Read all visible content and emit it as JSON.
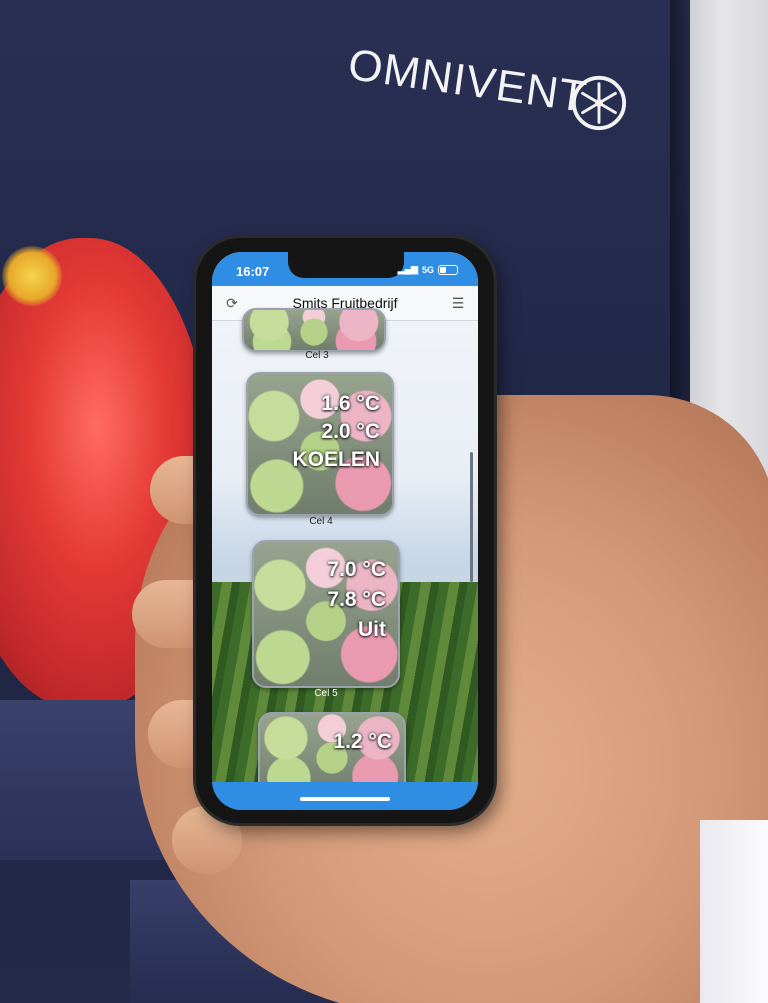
{
  "brand": {
    "name": "OMNIVENT",
    "icon": "fan-icon"
  },
  "phone": {
    "status_bar": {
      "time": "16:07",
      "network": "5G",
      "signal_icon": "signal-icon",
      "battery_icon": "battery-icon"
    },
    "header": {
      "title": "Smits Fruitbedrijf",
      "refresh_icon": "refresh-icon",
      "menu_icon": "list-menu-icon"
    },
    "cells": [
      {
        "label": "Cel 3",
        "temp1": "",
        "temp2": "",
        "status": ""
      },
      {
        "label": "Cel 4",
        "temp1": "1.6 °C",
        "temp2": "2.0 °C",
        "status": "KOELEN"
      },
      {
        "label": "Cel 5",
        "temp1": "7.0 °C",
        "temp2": "7.8 °C",
        "status": "Uit"
      },
      {
        "label": "",
        "temp1": "1.2 °C",
        "temp2": "",
        "status": ""
      }
    ]
  },
  "colors": {
    "accent_blue": "#2f8ee3",
    "header_bg": "#f7f8fa",
    "backdrop": "#1e2442"
  }
}
